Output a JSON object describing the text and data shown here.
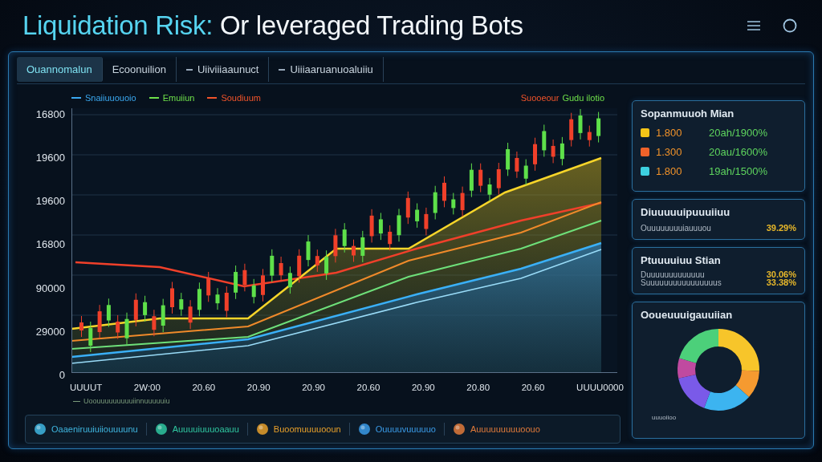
{
  "title": {
    "highlight": "Liquidation Risk:",
    "text": "Or leveraged Trading Bots"
  },
  "tabs": [
    {
      "label": "Ouannomalun",
      "selected": true,
      "dash": false
    },
    {
      "label": "Ecoonuilion",
      "selected": false,
      "dash": false
    },
    {
      "label": "Uiiviiiaaunuct",
      "selected": false,
      "dash": true
    },
    {
      "label": "Uiiiaaruanuoaluiiu",
      "selected": false,
      "dash": true
    }
  ],
  "legend": [
    {
      "label": "Snaiiuuouoio",
      "color": "#3aa8f0"
    },
    {
      "label": "Emuiiun",
      "color": "#6ee04a"
    },
    {
      "label": "Soudiuum",
      "color": "#f0532a"
    }
  ],
  "chart_note": [
    {
      "label": "Suooeour",
      "color": "#f0532a"
    },
    {
      "label": "Gudu ilotio",
      "color": "#6ee04a"
    }
  ],
  "y_labels": [
    "16800",
    "19600",
    "19600",
    "16800",
    "90000",
    "29000",
    "0"
  ],
  "x_labels": [
    "UUUUT",
    "2W:00",
    "20.60",
    "20.90",
    "20.90",
    "20.60",
    "20.90",
    "20.80",
    "20.60",
    "UUUU0000"
  ],
  "caption": "Uoouuuuuuuuuiinnuuuuuiu",
  "bottom_items": [
    {
      "label": "Oaaeniruuiuiiouuuunu",
      "color": "#3fb6e0"
    },
    {
      "label": "Auuuuiuuuoaauu",
      "color": "#2fc7a0"
    },
    {
      "label": "Buoomuuuuooun",
      "color": "#e8a02a"
    },
    {
      "label": "Ouuuuvuuuuuo",
      "color": "#3a9be8"
    },
    {
      "label": "Auuuuuuuuuoouo",
      "color": "#e07a3a"
    }
  ],
  "summary": {
    "title": "Sopanmuuoh Mian",
    "rows": [
      {
        "color": "#f5c518",
        "value": "1.800",
        "reading": "20ah/1900%"
      },
      {
        "color": "#f0622a",
        "value": "1.300",
        "reading": "20au/1600%"
      },
      {
        "color": "#3dd0e0",
        "value": "1.800",
        "reading": "19ah/1500%"
      }
    ]
  },
  "distribution": {
    "title": "Diuuuuuipuuuiiuu",
    "label": "Ouuuuuuuuiauuuou",
    "value": "39.29%"
  },
  "position": {
    "title": "Ptuuuuiuu Stian",
    "lines": [
      {
        "label": "Duuuuuuuuuuuuu",
        "value": "30.06%"
      },
      {
        "label": "Suuuuuuuuuuuuuuuus",
        "value": "33.38%"
      }
    ]
  },
  "allocation": {
    "title": "Ooueuuuigauuiian",
    "label": "uuuoiioo"
  }
}
